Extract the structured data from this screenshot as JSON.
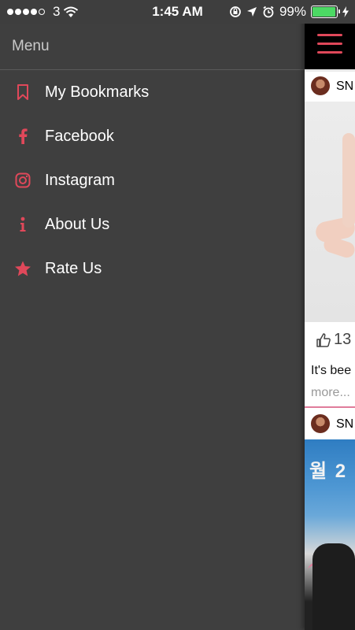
{
  "status_bar": {
    "carrier": "3",
    "time": "1:45 AM",
    "battery": "99%"
  },
  "colors": {
    "accent": "#e0485a",
    "drawer_bg": "#3f3f3f",
    "battery": "#4cd964"
  },
  "menu": {
    "title": "Menu",
    "items": [
      {
        "label": "My Bookmarks",
        "icon": "bookmark-icon"
      },
      {
        "label": "Facebook",
        "icon": "facebook-icon"
      },
      {
        "label": "Instagram",
        "icon": "instagram-icon"
      },
      {
        "label": "About Us",
        "icon": "info-icon"
      },
      {
        "label": "Rate Us",
        "icon": "star-icon"
      }
    ]
  },
  "feed": {
    "posts": [
      {
        "author": "SN",
        "likes": "13",
        "caption": "It's bee",
        "more": "more..."
      },
      {
        "author": "SN",
        "image_text": "월 2"
      }
    ]
  }
}
